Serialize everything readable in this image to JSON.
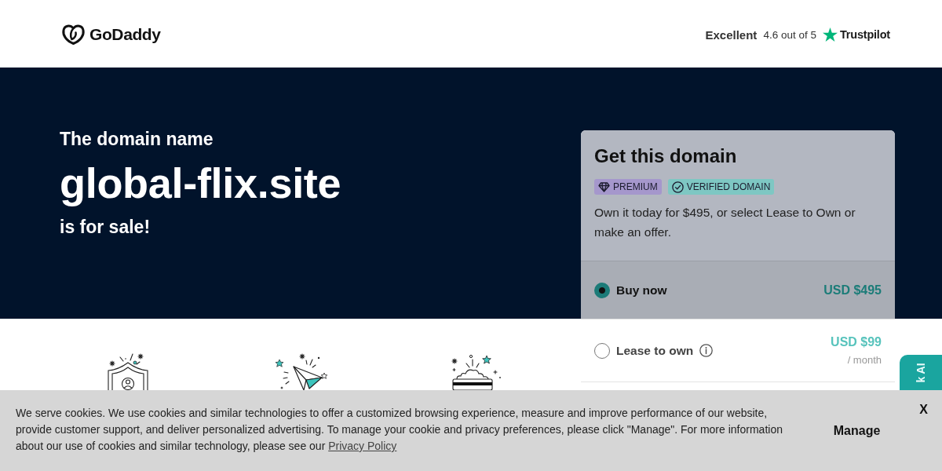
{
  "header": {
    "logo": "GoDaddy",
    "rating": {
      "label": "Excellent",
      "score": "4.6 out of 5",
      "brand": "Trustpilot"
    }
  },
  "hero": {
    "intro": "The domain name",
    "domain": "global-flix.site",
    "outro": "is for sale!"
  },
  "card": {
    "title": "Get this domain",
    "badges": [
      {
        "kind": "premium",
        "label": "PREMIUM",
        "color": "#a597cc"
      },
      {
        "kind": "verified",
        "label": "VERIFIED DOMAIN",
        "color": "#7ec7c3"
      }
    ],
    "description": "Own it today for $495, or select Lease to Own or make an offer.",
    "options": [
      {
        "label": "Buy now",
        "price": "USD $495",
        "selected": true,
        "info": false
      },
      {
        "label": "Lease to own",
        "price": "USD $99",
        "period": "/ month",
        "selected": false,
        "info": true
      }
    ]
  },
  "cookie_banner": {
    "text": "We serve cookies. We use cookies and similar technologies to offer a customized browsing experience, measure and improve performance of our website, provide customer support, and deliver personalized advertising. To manage your cookie and privacy preferences, please click \"Manage\". For more information about our use of cookies and similar technology, please see our",
    "link": "Privacy Policy",
    "manage": "Manage",
    "close": "X"
  },
  "assistant_tab": {
    "label": "k AI"
  }
}
